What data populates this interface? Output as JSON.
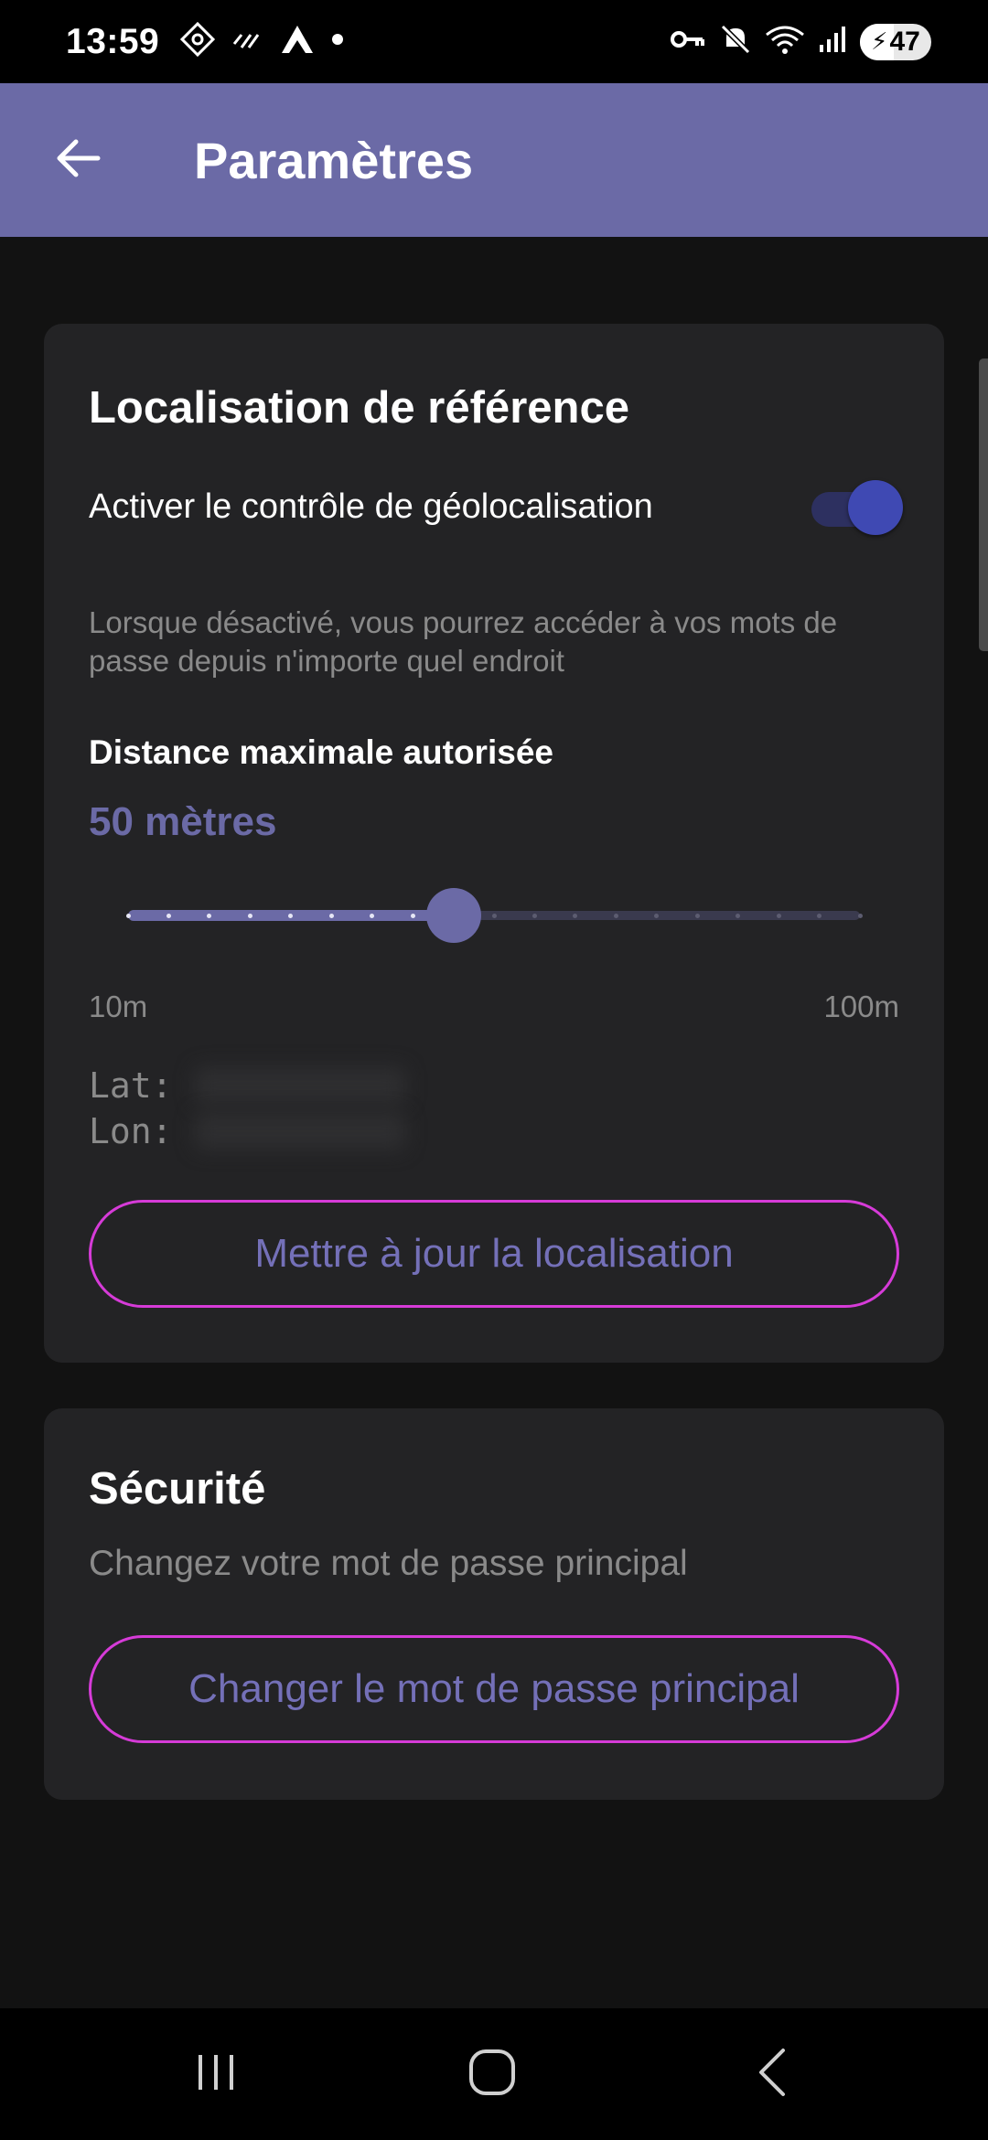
{
  "status_bar": {
    "time": "13:59",
    "battery_percent": "47",
    "battery_level": 0.47,
    "left_icons": [
      "tiktok-icon",
      "dnd-lines-icon",
      "nordvpn-icon",
      "notification-dot-icon"
    ],
    "right_icons": [
      "vpn-key-icon",
      "mute-icon",
      "wifi-icon",
      "signal-icon",
      "battery-icon"
    ]
  },
  "app_bar": {
    "title": "Paramètres",
    "back_icon": "arrow-left-icon"
  },
  "location_card": {
    "title": "Localisation de référence",
    "toggle_label": "Activer le contrôle de géolocalisation",
    "toggle_on": true,
    "hint": "Lorsque désactivé, vous pourrez accéder à vos mots de passe depuis n'importe quel endroit",
    "distance_heading": "Distance maximale autorisée",
    "distance_value": "50 mètres",
    "slider": {
      "min": 10,
      "max": 100,
      "step": 5,
      "value": 50,
      "min_label": "10m",
      "max_label": "100m"
    },
    "lat_label": "Lat:",
    "lon_label": "Lon:",
    "update_button": "Mettre à jour la localisation"
  },
  "security_card": {
    "title": "Sécurité",
    "description": "Changez votre mot de passe principal",
    "change_button": "Changer le mot de passe principal"
  },
  "colors": {
    "app_bar": "#6b6aa6",
    "accent": "#6b6aa6",
    "toggle_thumb": "#3f49b3",
    "button_border": "#d63bd8",
    "card": "#232325",
    "background": "#121212"
  },
  "nav_bar": {
    "buttons": [
      "recent-apps-icon",
      "home-icon",
      "back-icon"
    ]
  }
}
